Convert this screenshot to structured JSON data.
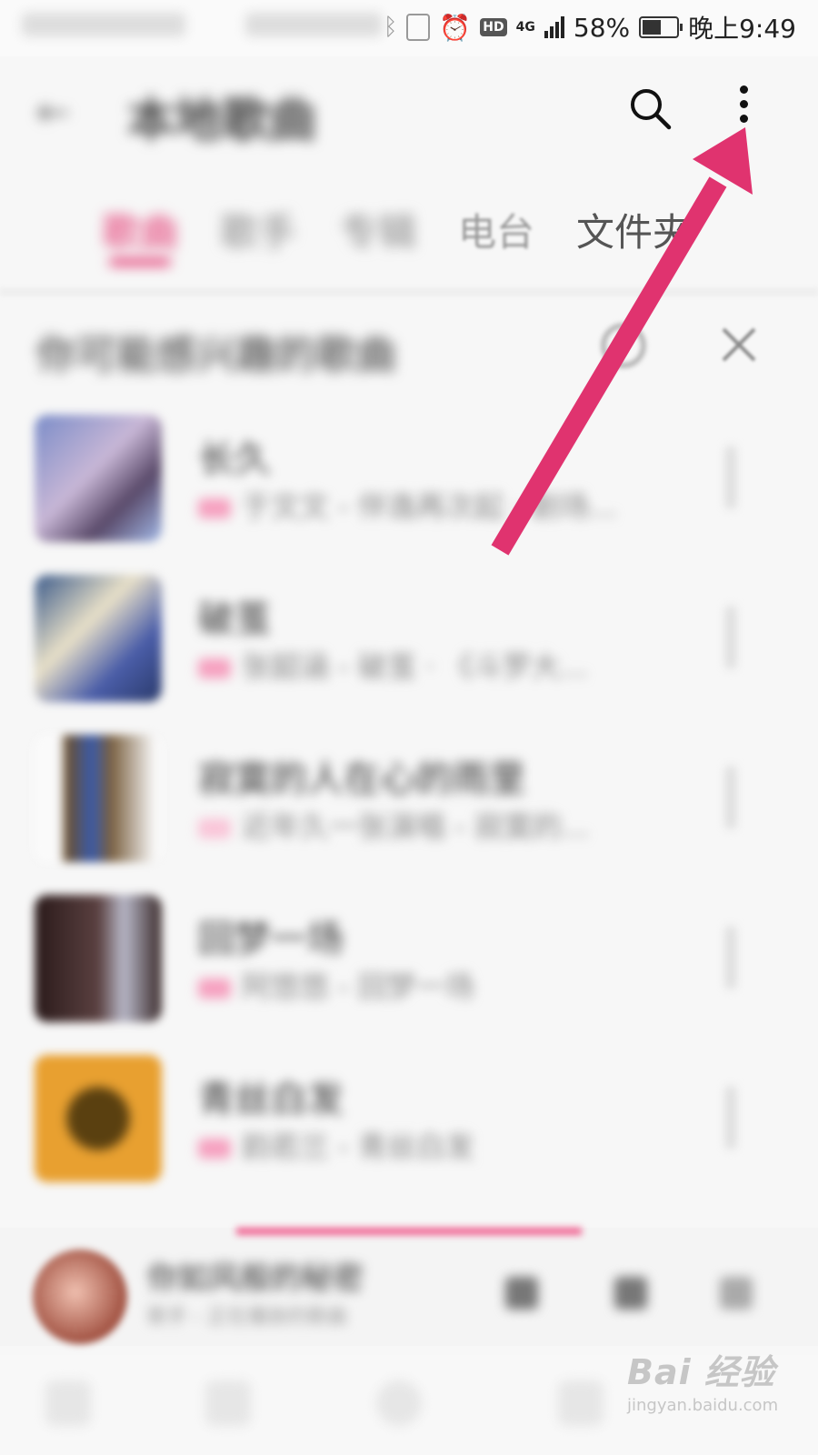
{
  "status_bar": {
    "battery_percent": "58%",
    "time": "晚上9:49",
    "hd_label": "HD",
    "network_label": "4G"
  },
  "header": {
    "back_icon": "back-arrow-icon",
    "title": "本地歌曲",
    "search_icon": "search-icon",
    "more_icon": "more-vertical-icon"
  },
  "tabs": [
    {
      "label": "歌曲",
      "active": true
    },
    {
      "label": "歌手",
      "active": false
    },
    {
      "label": "专辑",
      "active": false
    },
    {
      "label": "电台",
      "active": false
    },
    {
      "label": "文件夹",
      "active": false
    }
  ],
  "section": {
    "title": "你可能感兴趣的歌曲",
    "refresh_icon": "refresh-icon",
    "close_icon": "close-icon"
  },
  "songs": [
    {
      "name": "长久",
      "subtitle": "于文文 - 伴逸再次起 · 剧场..."
    },
    {
      "name": "破茧",
      "subtitle": "张韶涵 - 破茧 · 《斗罗大..."
    },
    {
      "name": "寂寞的人在心的雨里",
      "subtitle": "近年久一张演唱 - 寂寞的..."
    },
    {
      "name": "回梦一场",
      "subtitle": "阿悠悠 - 回梦一场"
    },
    {
      "name": "青丝白发",
      "subtitle": "韵若兰 - 青丝白发"
    }
  ],
  "player": {
    "title": "你如风般的秘密",
    "subtitle": "歌手 - 正在播放的歌曲"
  },
  "annotation": {
    "arrow_color": "#e0336f"
  },
  "watermark": {
    "logo": "Bai 经验",
    "url": "jingyan.baidu.com"
  },
  "colors": {
    "accent": "#e2306c"
  }
}
